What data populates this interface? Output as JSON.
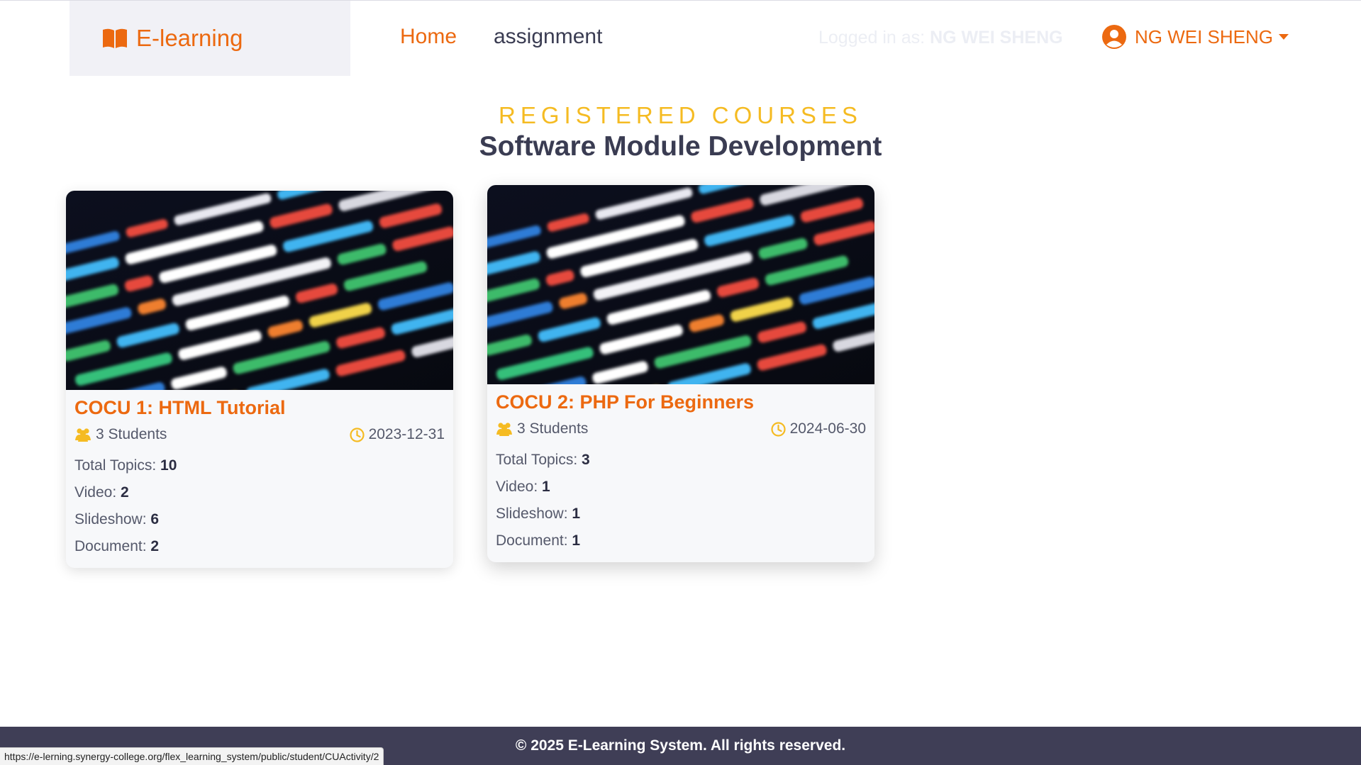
{
  "navbar": {
    "brand": "E-learning",
    "brand_icon": "open-book-icon",
    "links": {
      "home": "Home",
      "assignment": "assignment"
    },
    "login_prefix": "Logged in as:",
    "login_name": "NG WEI SHENG",
    "user_menu_label": "NG WEI SHENG",
    "user_icon": "user-circle-icon"
  },
  "section": {
    "subtitle": "REGISTERED COURSES",
    "title": "Software Module Development"
  },
  "cards": [
    {
      "title": "COCU 1: HTML Tutorial",
      "students": "3 Students",
      "date": "2023-12-31",
      "stats": [
        {
          "label": "Total Topics: ",
          "value": "10"
        },
        {
          "label": "Video: ",
          "value": "2"
        },
        {
          "label": "Slideshow: ",
          "value": "6"
        },
        {
          "label": "Document: ",
          "value": "2"
        }
      ]
    },
    {
      "title": "COCU 2: PHP For Beginners",
      "students": "3 Students",
      "date": "2024-06-30",
      "stats": [
        {
          "label": "Total Topics: ",
          "value": "3"
        },
        {
          "label": "Video: ",
          "value": "1"
        },
        {
          "label": "Slideshow: ",
          "value": "1"
        },
        {
          "label": "Document: ",
          "value": "1"
        }
      ]
    }
  ],
  "footer": {
    "text": "© 2025 E-Learning System. All rights reserved."
  },
  "status_bar": {
    "url": "https://e-lerning.synergy-college.org/flex_learning_system/public/student/CUActivity/2"
  },
  "colors": {
    "accent": "#ec6910",
    "heading_gold": "#f5bb22",
    "dark_text": "#3a3c52",
    "footer_bg": "#3f3e56"
  }
}
